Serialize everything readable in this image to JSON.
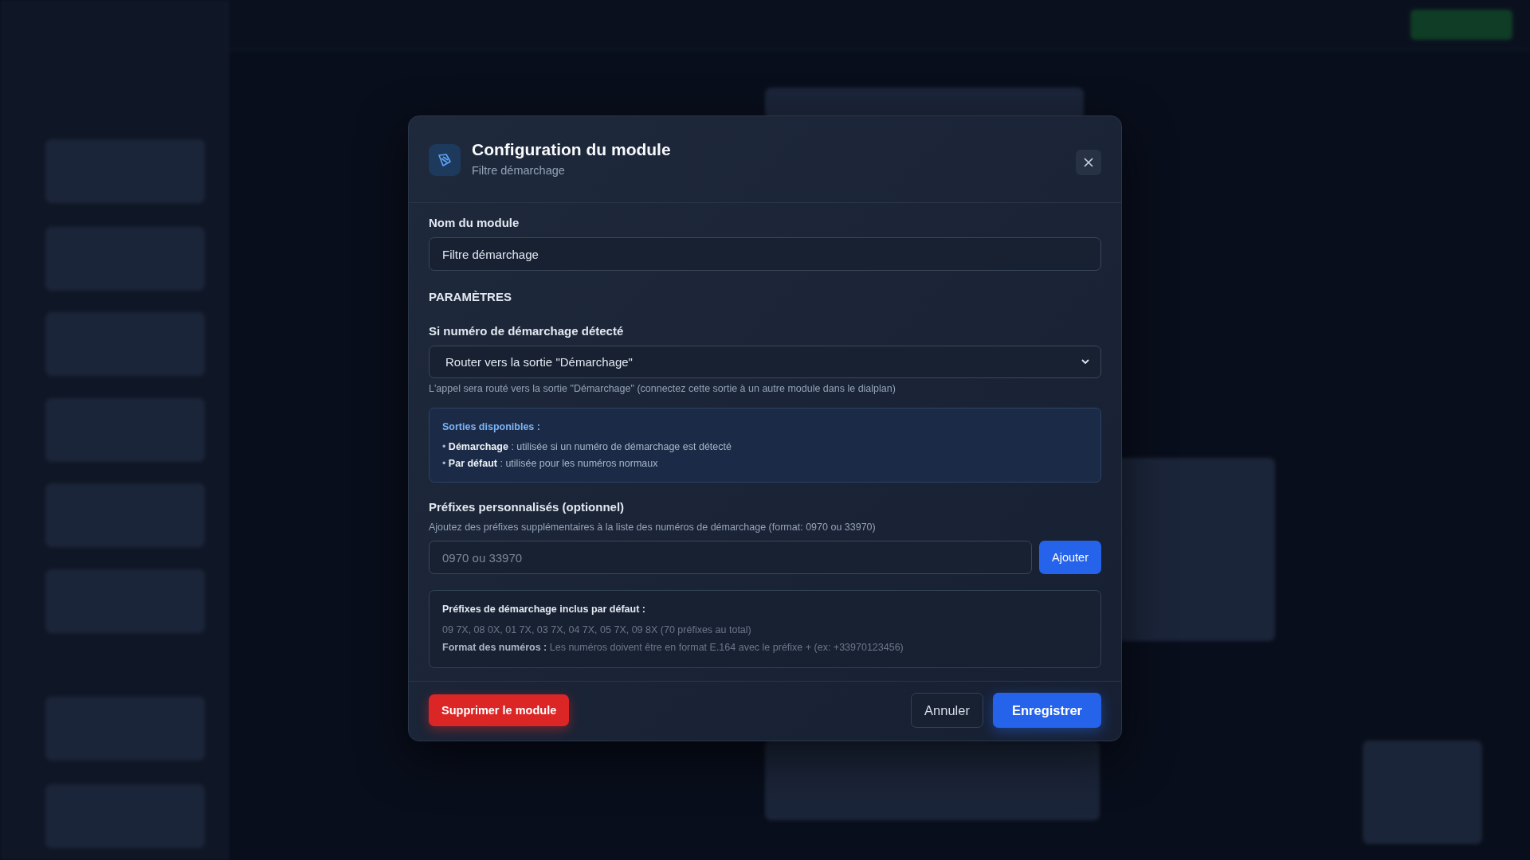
{
  "modal": {
    "title": "Configuration du module",
    "subtitle": "Filtre démarchage"
  },
  "name_field": {
    "label": "Nom du module",
    "value": "Filtre démarchage"
  },
  "section_heading": "PARAMÈTRES",
  "action_select": {
    "label": "Si numéro de démarchage détecté",
    "value": "Router vers la sortie \"Démarchage\"",
    "help": "L'appel sera routé vers la sortie \"Démarchage\" (connectez cette sortie à un autre module dans le dialplan)"
  },
  "outputs_info": {
    "title": "Sorties disponibles :",
    "items": [
      "• **Démarchage** : utilisée si un numéro de démarchage est détecté",
      "• **Par défaut** : utilisée pour les numéros normaux"
    ]
  },
  "custom_prefixes": {
    "label": "Préfixes personnalisés (optionnel)",
    "help": "Ajoutez des préfixes supplémentaires à la liste des numéros de démarchage (format: 0970 ou 33970)",
    "placeholder": "0970 ou 33970",
    "add_button": "Ajouter"
  },
  "defaults_info": {
    "title": "Préfixes de démarchage inclus par défaut :",
    "prefixes": "09 7X, 08 0X, 01 7X, 03 7X, 04 7X, 05 7X, 09 8X (70 préfixes au total)",
    "format": "**Format des numéros :** Les numéros doivent être en format E.164 avec le préfixe + (ex: +33970123456)"
  },
  "buttons": {
    "delete": "Supprimer le module",
    "cancel": "Annuler",
    "save": "Enregistrer"
  }
}
